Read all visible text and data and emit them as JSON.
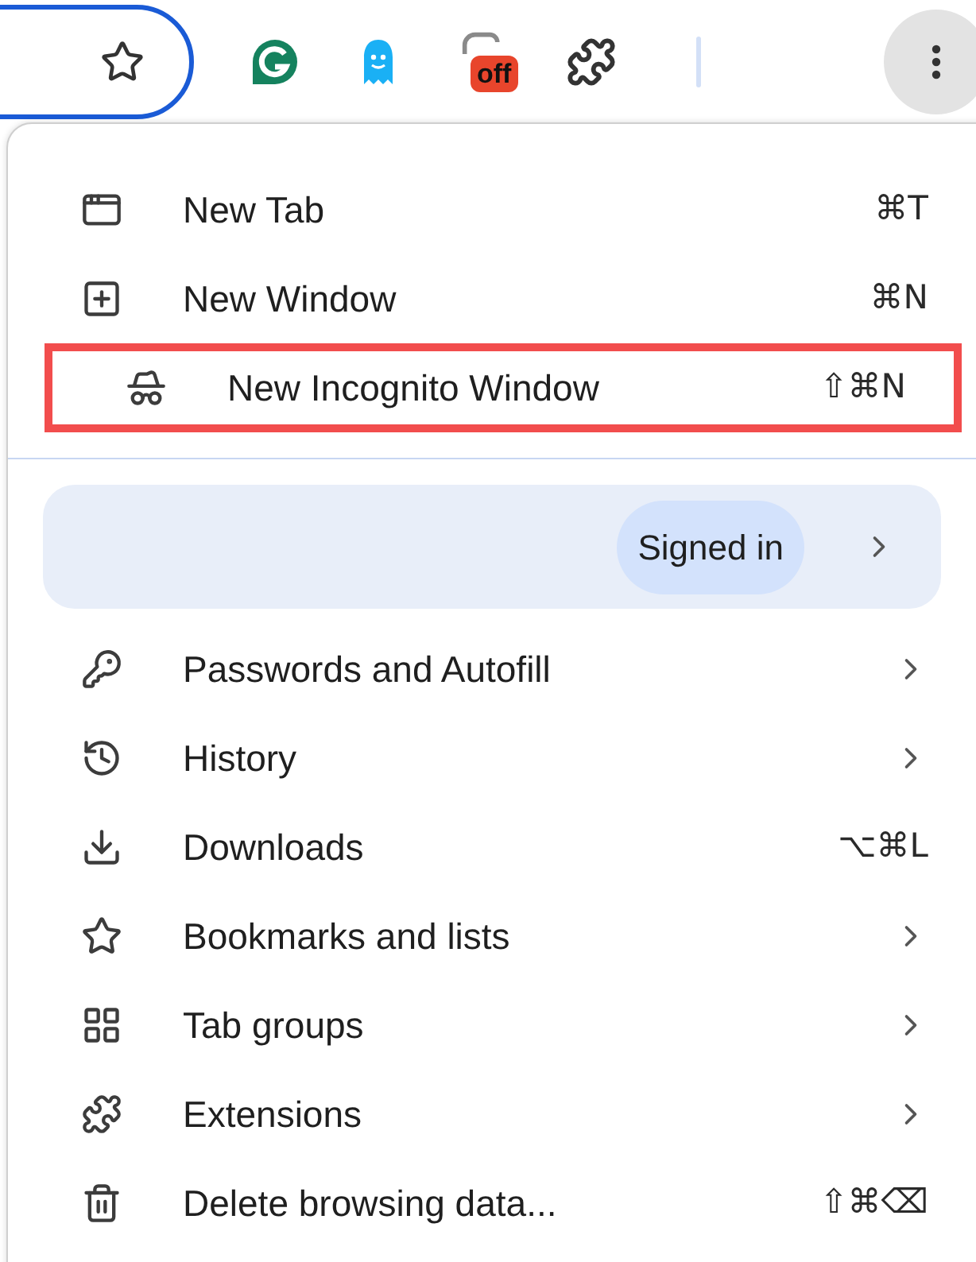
{
  "toolbar": {
    "extension_badge": "off"
  },
  "menu": {
    "groups": [
      [
        {
          "label": "New Tab",
          "kind": "shortcut",
          "shortcut": "⌘T",
          "highlighted": false
        },
        {
          "label": "New Window",
          "kind": "shortcut",
          "shortcut": "⌘N",
          "highlighted": false
        },
        {
          "label": "New Incognito Window",
          "kind": "shortcut",
          "shortcut": "⇧⌘N",
          "highlighted": true
        }
      ]
    ],
    "profile": {
      "status": "Signed in"
    },
    "items": [
      {
        "label": "Passwords and Autofill",
        "kind": "submenu"
      },
      {
        "label": "History",
        "kind": "submenu"
      },
      {
        "label": "Downloads",
        "kind": "shortcut",
        "shortcut": "⌥⌘L"
      },
      {
        "label": "Bookmarks and lists",
        "kind": "submenu"
      },
      {
        "label": "Tab groups",
        "kind": "submenu"
      },
      {
        "label": "Extensions",
        "kind": "submenu"
      },
      {
        "label": "Delete browsing data...",
        "kind": "shortcut",
        "shortcut": "⇧⌘⌫"
      }
    ]
  }
}
